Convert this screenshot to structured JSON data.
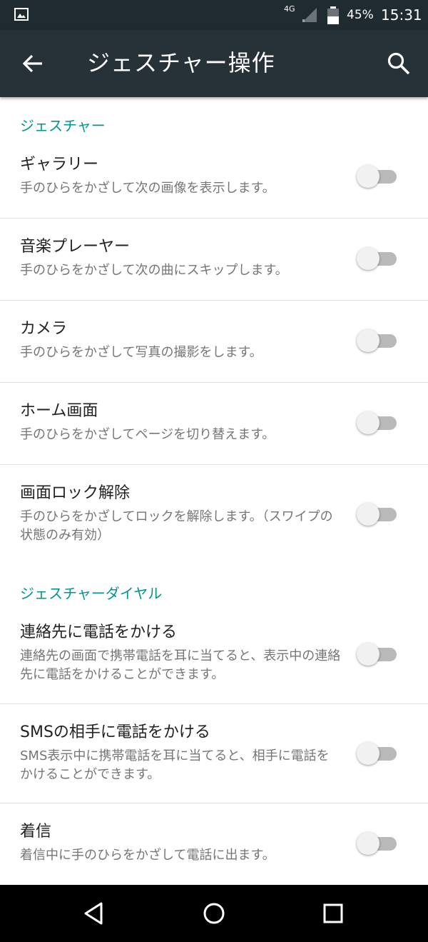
{
  "status_bar": {
    "network": "4G",
    "battery_percent": "45%",
    "time": "15:31"
  },
  "app_bar": {
    "title": "ジェスチャー操作",
    "icons": [
      "back-arrow-icon",
      "search-icon"
    ]
  },
  "sections": [
    {
      "header": "ジェスチャー",
      "items": [
        {
          "title": "ギャラリー",
          "subtitle": "手のひらをかざして次の画像を表示します。",
          "enabled": false
        },
        {
          "title": "音楽プレーヤー",
          "subtitle": "手のひらをかざして次の曲にスキップします。",
          "enabled": false
        },
        {
          "title": "カメラ",
          "subtitle": "手のひらをかざして写真の撮影をします。",
          "enabled": false
        },
        {
          "title": "ホーム画面",
          "subtitle": "手のひらをかざしてページを切り替えます。",
          "enabled": false
        },
        {
          "title": "画面ロック解除",
          "subtitle": "手のひらをかざしてロックを解除します。（スワイプの状態のみ有効）",
          "enabled": false
        }
      ]
    },
    {
      "header": "ジェスチャーダイヤル",
      "items": [
        {
          "title": "連絡先に電話をかける",
          "subtitle": "連絡先の画面で携帯電話を耳に当てると、表示中の連絡先に電話をかけることができます。",
          "enabled": false
        },
        {
          "title": "SMSの相手に電話をかける",
          "subtitle": "SMS表示中に携帯電話を耳に当てると、相手に電話をかけることができます。",
          "enabled": false
        },
        {
          "title": "着信",
          "subtitle": "着信中に手のひらをかざして電話に出ます。",
          "enabled": false
        }
      ]
    }
  ],
  "nav_bar": {
    "buttons": [
      "back-triangle-icon",
      "home-circle-icon",
      "recents-square-icon"
    ]
  },
  "colors": {
    "status_bar_bg": "#1f2b31",
    "app_bar_bg": "#263238",
    "accent": "#00968a",
    "switch_track_off": "#b9b9b9",
    "switch_thumb_off": "#f1f1f1"
  }
}
